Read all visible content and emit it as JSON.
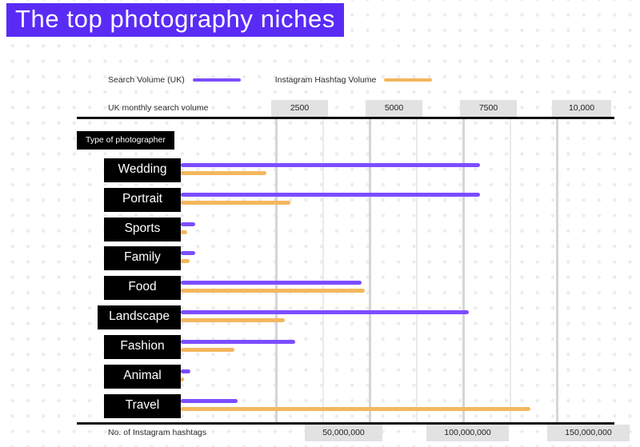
{
  "title": "The top photography niches",
  "colors": {
    "title_bg": "#5a2bf5",
    "search_series": "#7c4dff",
    "hashtag_series": "#f3b75e",
    "label_bg": "#000000",
    "axis_rule": "#111111"
  },
  "legend": {
    "items": [
      {
        "label": "Search Volume (UK)",
        "color": "#7c4dff",
        "swatch": "line-swatch"
      },
      {
        "label": "Instagram Hashtag Volume",
        "color": "#f3b75e",
        "swatch": "line-swatch"
      }
    ]
  },
  "axes": {
    "top": {
      "name": "UK monthly search volume",
      "ticks": [
        "2500",
        "5000",
        "7500",
        "10,000"
      ]
    },
    "bottom": {
      "name": "No. of Instagram hashtags",
      "ticks": [
        "50,000,000",
        "100,000,000",
        "150,000,000"
      ]
    }
  },
  "category_header": "Type of photographer",
  "chart_data": {
    "type": "bar",
    "title": "The top photography niches",
    "orientation": "horizontal",
    "grid": true,
    "legend_position": "top-left",
    "categories": [
      "Wedding",
      "Portrait",
      "Sports",
      "Family",
      "Food",
      "Landscape",
      "Fashion",
      "Animal",
      "Travel"
    ],
    "xlabel": "UK monthly search volume",
    "xlabel_secondary": "No. of Instagram hashtags",
    "ylabel": "Type of photographer",
    "xlim": [
      0,
      10800
    ],
    "xlim_secondary": [
      0,
      162000000
    ],
    "xticks": [
      2500,
      5000,
      7500,
      10000
    ],
    "xticks_secondary": [
      50000000,
      100000000,
      150000000
    ],
    "series": [
      {
        "name": "Search Volume (UK)",
        "color": "#7c4dff",
        "axis": "top",
        "values": [
          8100,
          8100,
          400,
          400,
          4900,
          7800,
          3100,
          250,
          1550
        ]
      },
      {
        "name": "Instagram Hashtag Volume",
        "color": "#f3b75e",
        "axis": "bottom",
        "values": [
          24000000,
          31000000,
          1800000,
          2500000,
          53000000,
          30000000,
          15000000,
          800000,
          100000000
        ]
      }
    ]
  }
}
